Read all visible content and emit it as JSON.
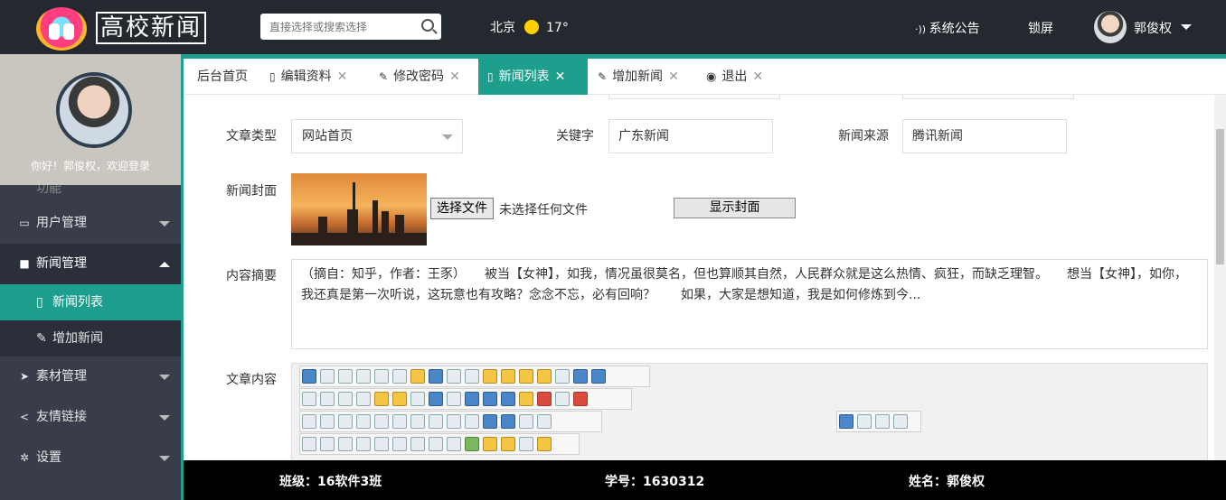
{
  "header": {
    "logo_text": "高校新闻",
    "search_placeholder": "直接选择或搜索选择",
    "weather_city": "北京",
    "weather_temp": "17°",
    "notice_label": "系统公告",
    "lock_label": "锁屏",
    "user_name": "郭俊权"
  },
  "sidebar": {
    "welcome": "你好！郭俊权，欢迎登录",
    "cut_item": "功能",
    "items": [
      {
        "label": "用户管理",
        "icon": "monitor-icon"
      },
      {
        "label": "新闻管理",
        "icon": "folder-icon"
      },
      {
        "label": "素材管理",
        "icon": "send-icon"
      },
      {
        "label": "友情链接",
        "icon": "share-icon"
      },
      {
        "label": "设置",
        "icon": "gear-icon"
      }
    ],
    "sub_items": [
      {
        "label": "新闻列表",
        "icon": "file-icon"
      },
      {
        "label": "增加新闻",
        "icon": "pencil-icon"
      }
    ]
  },
  "tabs": [
    {
      "label": "后台首页"
    },
    {
      "label": "编辑资料"
    },
    {
      "label": "修改密码"
    },
    {
      "label": "新闻列表"
    },
    {
      "label": "增加新闻"
    },
    {
      "label": "退出"
    }
  ],
  "form": {
    "type_label": "文章类型",
    "type_value": "网站首页",
    "keyword_label": "关键字",
    "keyword_value": "广东新闻",
    "source_label": "新闻来源",
    "source_value": "腾讯新闻",
    "cover_label": "新闻封面",
    "choose_file": "选择文件",
    "no_file": "未选择任何文件",
    "show_cover": "显示封面",
    "summary_label": "内容摘要",
    "summary_text": "（摘自：知乎，作者：王豕）　　被当【女神】，如我，情况虽很莫名，但也算顺其自然，人民群众就是这么热情、疯狂，而缺乏理智。　　想当【女神】，如你，我还真是第一次听说，这玩意也有攻略？念念不忘，必有回响？　　如果，大家是想知道，我是如何修炼到今...",
    "content_label": "文章内容"
  },
  "footer": {
    "class_label": "班级：16软件3班",
    "id_label": "学号：1630312",
    "name_label": "姓名：郭俊权"
  }
}
